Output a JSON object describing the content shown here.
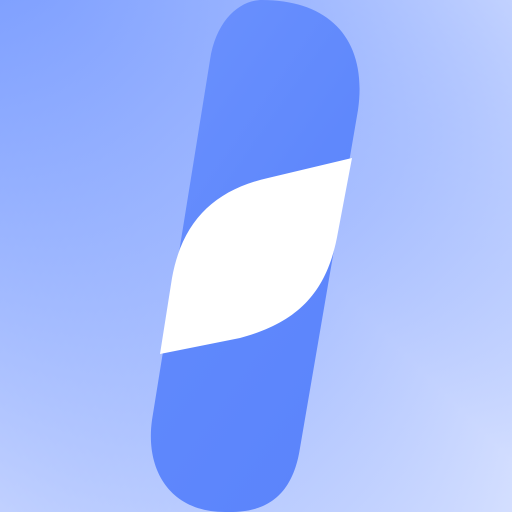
{
  "icon": {
    "semantic_name": "app-logo-icon",
    "colors": {
      "background_light": "#d7e1ff",
      "background_mid": "#a9bfff",
      "background_strong": "#7fa0ff",
      "shape_light": "#7397ff",
      "shape_dark": "#5a83fb",
      "cutout": "#ffffff"
    }
  }
}
